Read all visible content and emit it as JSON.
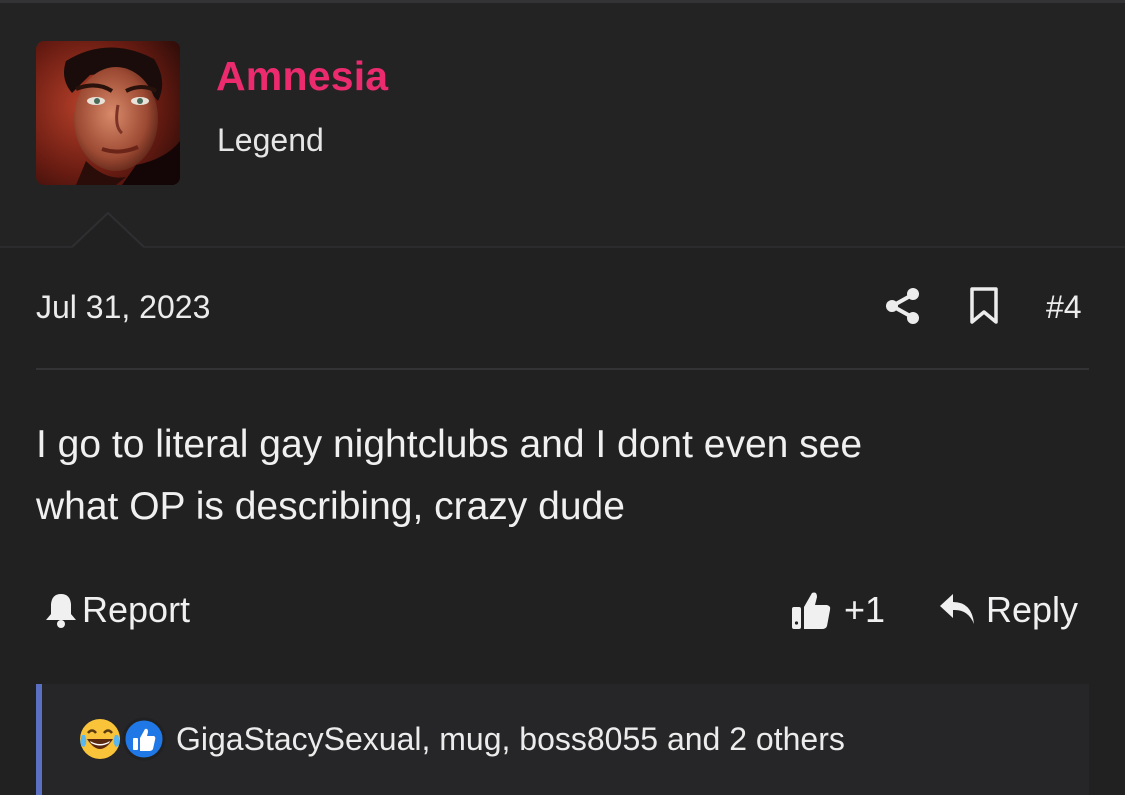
{
  "post": {
    "author": {
      "username": "Amnesia",
      "title": "Legend"
    },
    "date": "Jul 31, 2023",
    "number": "#4",
    "body_line1": "I go to literal gay nightclubs and I dont even see",
    "body_line2": "what OP is describing, crazy dude",
    "actions": {
      "report_label": "Report",
      "like_count": "+1",
      "reply_label": "Reply"
    },
    "reactions": {
      "icons": [
        "laughing-crying-emoji-icon",
        "thumbs-up-reaction-icon"
      ],
      "summary": "GigaStacySexual, mug, boss8055 and 2 others"
    }
  },
  "colors": {
    "background": "#212122",
    "username": "#ec2a6e",
    "reaction_accent": "#5a6fc2"
  }
}
